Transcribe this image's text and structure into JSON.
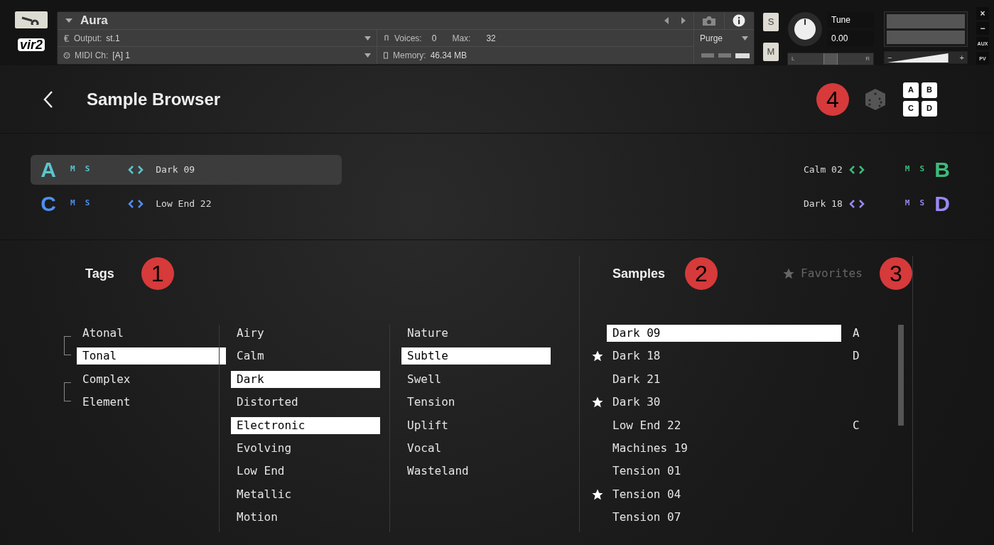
{
  "logo": "vir2",
  "instrument": {
    "name": "Aura",
    "output_label": "Output:",
    "output": "st.1",
    "midi_label": "MIDI Ch:",
    "midi": "[A] 1",
    "voices_label": "Voices:",
    "voices": "0",
    "max_label": "Max:",
    "max": "32",
    "memory_label": "Memory:",
    "memory": "46.34 MB",
    "purge": "Purge"
  },
  "rack_controls": {
    "solo": "S",
    "mute": "M",
    "tune_label": "Tune",
    "tune": "0.00",
    "pan_left": "L",
    "pan_right": "R",
    "pan": {
      "level": 0.5
    },
    "volume_minus": "−",
    "volume_plus": "+",
    "volume": {
      "level": 0.82
    }
  },
  "window_buttons": [
    "×",
    "−",
    "AUX",
    "PV"
  ],
  "browser": {
    "title": "Sample Browser",
    "badge": "4",
    "slot_grid": [
      "A",
      "B",
      "C",
      "D"
    ]
  },
  "slot_rows": [
    {
      "left": {
        "letter": "A",
        "color": "#5cc6cf",
        "selected": true,
        "mute": "M",
        "solo": "S",
        "sample": "Dark 09"
      },
      "right": {
        "letter": "B",
        "color": "#3dba7a",
        "selected": false,
        "mute": "M",
        "solo": "S",
        "sample": "Calm 02"
      }
    },
    {
      "left": {
        "letter": "C",
        "color": "#4f8ff0",
        "selected": false,
        "mute": "M",
        "solo": "S",
        "sample": "Low End 22"
      },
      "right": {
        "letter": "D",
        "color": "#9b87f2",
        "selected": false,
        "mute": "M",
        "solo": "S",
        "sample": "Dark 18"
      }
    }
  ],
  "tags": {
    "title": "Tags",
    "badge": "1",
    "columns": [
      {
        "kind": "grouped",
        "groups": [
          {
            "items": [
              {
                "label": "Atonal",
                "selected": false
              },
              {
                "label": "Tonal",
                "selected": true
              }
            ]
          },
          {
            "items": [
              {
                "label": "Complex",
                "selected": false
              },
              {
                "label": "Element",
                "selected": false
              }
            ]
          }
        ]
      },
      {
        "kind": "plain",
        "items": [
          {
            "label": "Airy",
            "selected": false
          },
          {
            "label": "Calm",
            "selected": false
          },
          {
            "label": "Dark",
            "selected": true
          },
          {
            "label": "Distorted",
            "selected": false
          },
          {
            "label": "Electronic",
            "selected": true
          },
          {
            "label": "Evolving",
            "selected": false
          },
          {
            "label": "Low End",
            "selected": false
          },
          {
            "label": "Metallic",
            "selected": false
          },
          {
            "label": "Motion",
            "selected": false
          }
        ]
      },
      {
        "kind": "plain",
        "items": [
          {
            "label": "Nature",
            "selected": false
          },
          {
            "label": "Subtle",
            "selected": true
          },
          {
            "label": "Swell",
            "selected": false
          },
          {
            "label": "Tension",
            "selected": false
          },
          {
            "label": "Uplift",
            "selected": false
          },
          {
            "label": "Vocal",
            "selected": false
          },
          {
            "label": "Wasteland",
            "selected": false
          }
        ]
      }
    ]
  },
  "samples": {
    "title": "Samples",
    "badge": "2",
    "favorites": {
      "label": "Favorites",
      "badge": "3"
    },
    "items": [
      {
        "name": "Dark 09",
        "favorite": false,
        "selected": true,
        "slot": "A"
      },
      {
        "name": "Dark 18",
        "favorite": true,
        "selected": false,
        "slot": "D"
      },
      {
        "name": "Dark 21",
        "favorite": false,
        "selected": false
      },
      {
        "name": "Dark 30",
        "favorite": true,
        "selected": false
      },
      {
        "name": "Low End 22",
        "favorite": false,
        "selected": false,
        "slot": "C"
      },
      {
        "name": "Machines 19",
        "favorite": false,
        "selected": false
      },
      {
        "name": "Tension 01",
        "favorite": false,
        "selected": false
      },
      {
        "name": "Tension 04",
        "favorite": true,
        "selected": false
      },
      {
        "name": "Tension 07",
        "favorite": false,
        "selected": false
      }
    ]
  }
}
